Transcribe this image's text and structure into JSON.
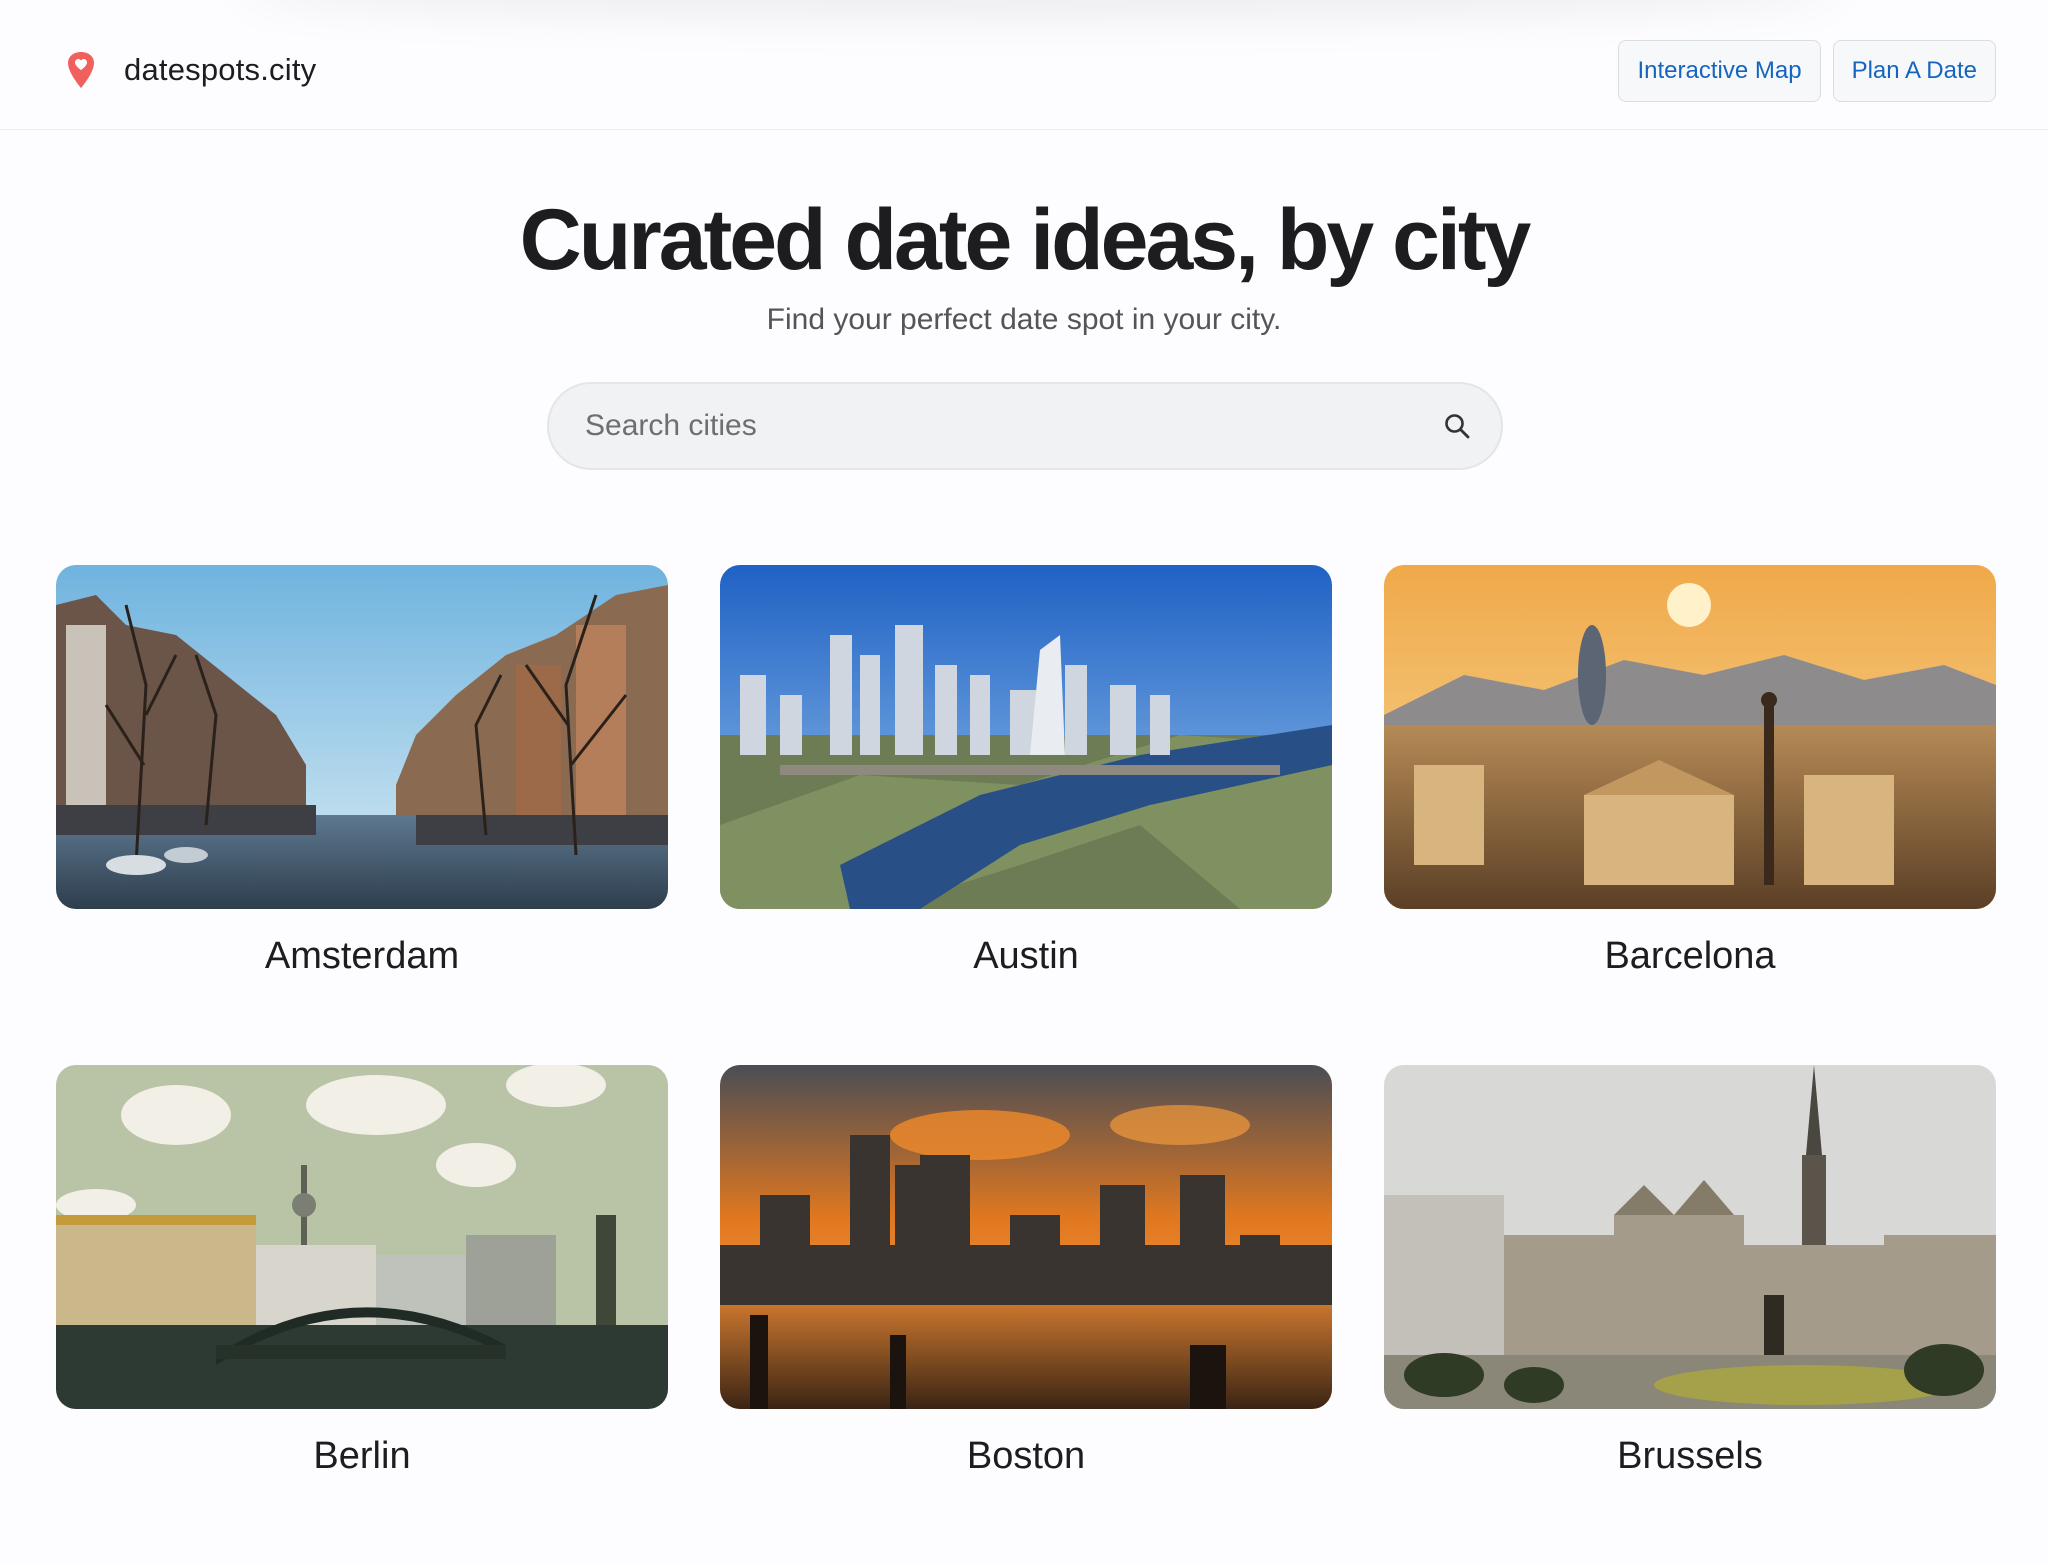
{
  "brand": {
    "name": "datespots.city",
    "icon": "heart-pin-icon",
    "icon_color": "#f0605d"
  },
  "nav": [
    {
      "label": "Interactive Map"
    },
    {
      "label": "Plan A Date"
    }
  ],
  "hero": {
    "title": "Curated date ideas, by city",
    "subtitle": "Find your perfect date spot in your city."
  },
  "search": {
    "placeholder": "Search cities",
    "value": "",
    "icon": "search-icon"
  },
  "colors": {
    "accent": "#1565c0",
    "background": "#fdfcfe",
    "text": "#1d1d1f"
  },
  "cities": [
    {
      "name": "Amsterdam"
    },
    {
      "name": "Austin"
    },
    {
      "name": "Barcelona"
    },
    {
      "name": "Berlin"
    },
    {
      "name": "Boston"
    },
    {
      "name": "Brussels"
    }
  ]
}
